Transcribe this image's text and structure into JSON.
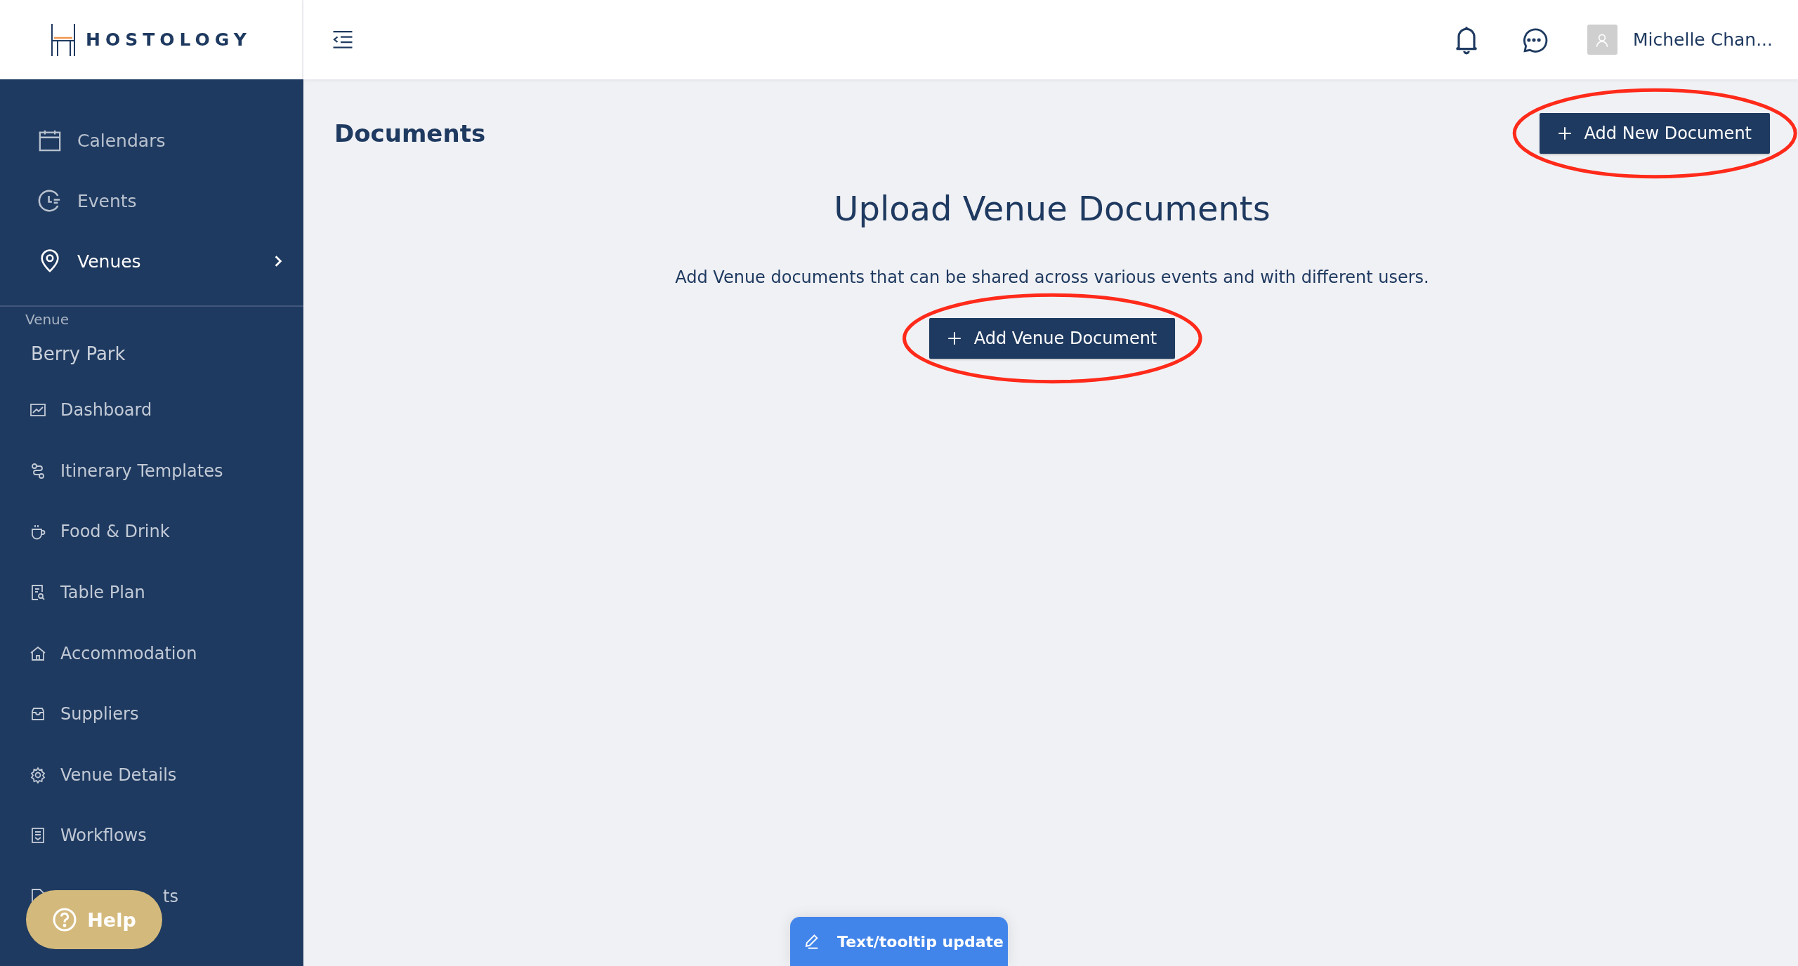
{
  "brand": {
    "name": "HOSTOLOGY"
  },
  "header": {
    "user_name": "Michelle Chan..."
  },
  "sidebar": {
    "nav": [
      {
        "label": "Calendars",
        "kind": "calendar",
        "selected": false
      },
      {
        "label": "Events",
        "kind": "clock",
        "selected": false
      },
      {
        "label": "Venues",
        "kind": "pin",
        "selected": true
      }
    ],
    "venue_heading": "Venue",
    "venue_name": "Berry Park",
    "venue_items": [
      {
        "label": "Dashboard",
        "kind": "chart"
      },
      {
        "label": "Itinerary Templates",
        "kind": "route"
      },
      {
        "label": "Food & Drink",
        "kind": "cup"
      },
      {
        "label": "Table Plan",
        "kind": "plan"
      },
      {
        "label": "Accommodation",
        "kind": "house"
      },
      {
        "label": "Suppliers",
        "kind": "bag"
      },
      {
        "label": "Venue Details",
        "kind": "gear"
      },
      {
        "label": "Workflows",
        "kind": "list"
      },
      {
        "label": "ts",
        "kind": "document",
        "covered": true
      }
    ]
  },
  "page": {
    "title": "Documents",
    "add_button": {
      "label": "Add New Document",
      "highlighted": true
    },
    "empty_state": {
      "title": "Upload Venue Documents",
      "text": "Add Venue documents that can be shared across various events and with different users.",
      "button": {
        "label": "Add Venue Document",
        "highlighted": true
      }
    }
  },
  "help_button": "Help",
  "feedback_button": "Text/tooltip update"
}
